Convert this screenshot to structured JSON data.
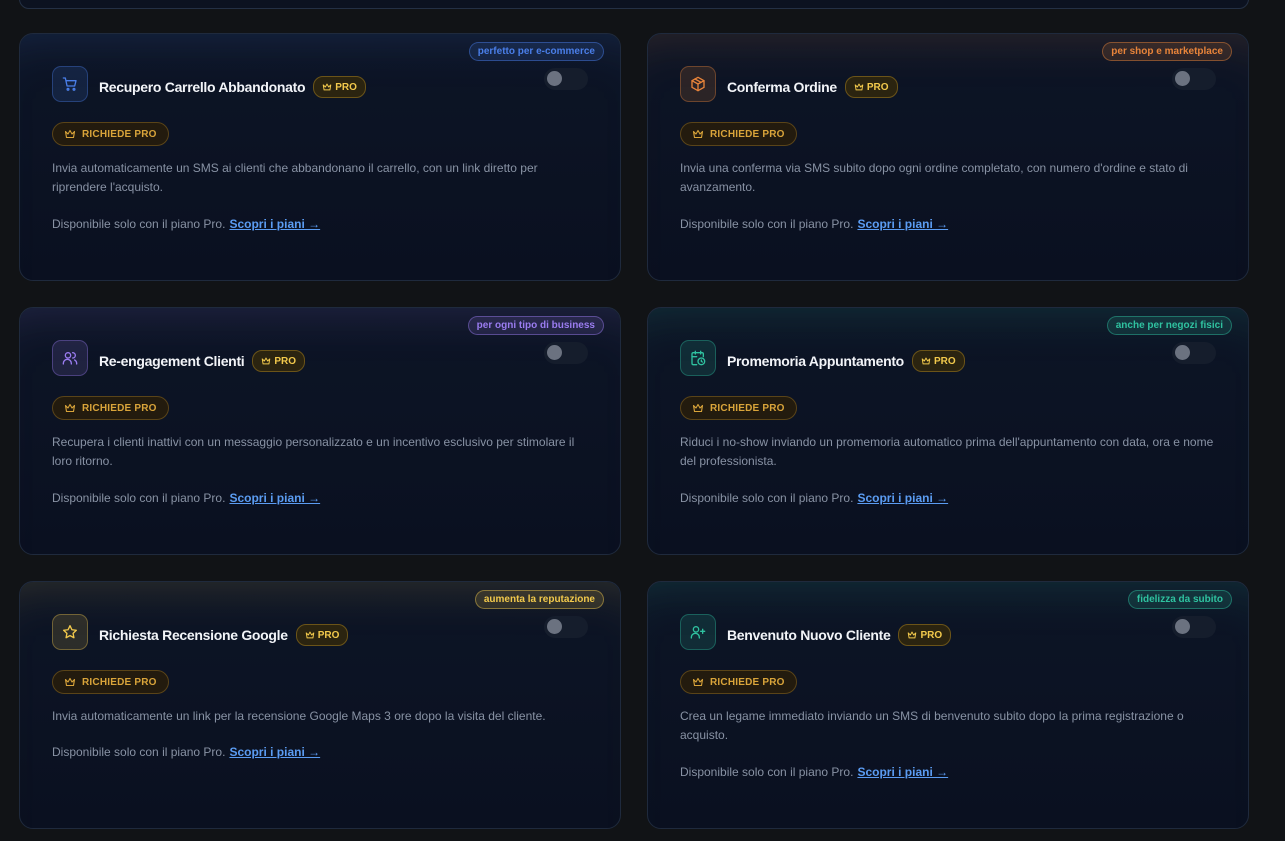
{
  "common": {
    "pro_label": "PRO",
    "requires_label": "RICHIEDE PRO",
    "availability_text": "Disponibile solo con il piano Pro.",
    "plans_link": "Scopri i piani →"
  },
  "cards": [
    {
      "title": "Recupero Carrello Abbandonato",
      "tag": "perfetto per e-commerce",
      "description": "Invia automaticamente un SMS ai clienti che abbandonano il carrello, con un link diretto per riprendere l'acquisto.",
      "icon": "shopping-cart-icon",
      "accent": "#4a7ee8",
      "enabled": false
    },
    {
      "title": "Conferma Ordine",
      "tag": "per shop e marketplace",
      "description": "Invia una conferma via SMS subito dopo ogni ordine completato, con numero d'ordine e stato di avanzamento.",
      "icon": "package-icon",
      "accent": "#e8843a",
      "enabled": false
    },
    {
      "title": "Re-engagement Clienti",
      "tag": "per ogni tipo di business",
      "description": "Recupera i clienti inattivi con un messaggio personalizzato e un incentivo esclusivo per stimolare il loro ritorno.",
      "icon": "users-icon",
      "accent": "#9a7cf0",
      "enabled": false
    },
    {
      "title": "Promemoria Appuntamento",
      "tag": "anche per negozi fisici",
      "description": "Riduci i no-show inviando un promemoria automatico prima dell'appuntamento con data, ora e nome del professionista.",
      "icon": "calendar-clock-icon",
      "accent": "#2fc2a0",
      "enabled": false
    },
    {
      "title": "Richiesta Recensione Google",
      "tag": "aumenta la reputazione",
      "description": "Invia automaticamente un link per la recensione Google Maps 3 ore dopo la visita del cliente.",
      "icon": "star-icon",
      "accent": "#f2c94c",
      "enabled": false
    },
    {
      "title": "Benvenuto Nuovo Cliente",
      "tag": "fidelizza da subito",
      "description": "Crea un legame immediato inviando un SMS di benvenuto subito dopo la prima registrazione o acquisto.",
      "icon": "user-plus-icon",
      "accent": "#2fc2a0",
      "enabled": false
    }
  ]
}
